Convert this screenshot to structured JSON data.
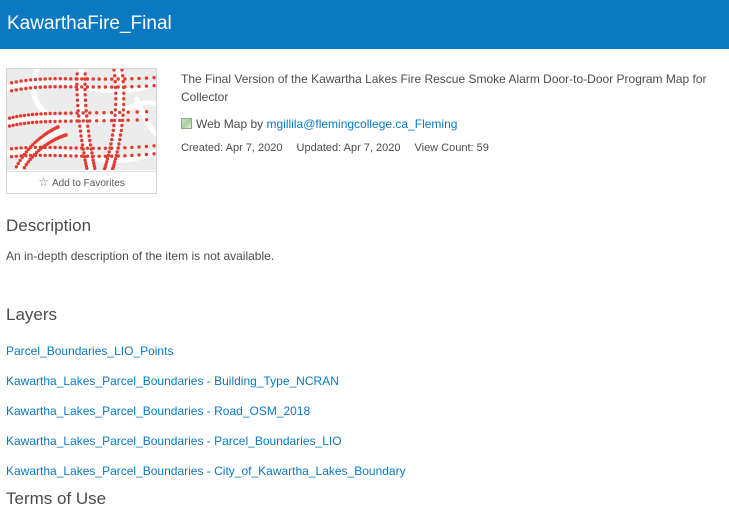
{
  "header": {
    "title": "KawarthaFire_Final",
    "bg_color": "#0a79c2"
  },
  "thumbnail": {
    "alt": "map thumbnail with red parcel points",
    "add_to_favorites_label": "Add to Favorites",
    "star_icon": "star-icon"
  },
  "item": {
    "summary": "The Final Version of the Kawartha Lakes Fire Rescue Smoke Alarm Door-to-Door Program Map for Collector",
    "type_icon": "webmap-icon",
    "type_label": "Web Map",
    "by_label": "by",
    "owner": "mgillila@flemingcollege.ca_Fleming",
    "created": "Created: Apr 7, 2020",
    "updated": "Updated: Apr 7, 2020",
    "view_count": "View Count: 59"
  },
  "description": {
    "title": "Description",
    "text": "An in-depth description of the item is not available."
  },
  "layers": {
    "title": "Layers",
    "items": [
      "Parcel_Boundaries_LIO_Points",
      "Kawartha_Lakes_Parcel_Boundaries - Building_Type_NCRAN",
      "Kawartha_Lakes_Parcel_Boundaries - Road_OSM_2018",
      "Kawartha_Lakes_Parcel_Boundaries - Parcel_Boundaries_LIO",
      "Kawartha_Lakes_Parcel_Boundaries - City_of_Kawartha_Lakes_Boundary"
    ]
  },
  "next_section": {
    "title": "Terms of Use"
  },
  "colors": {
    "accent": "#0a79c2",
    "text": "#4c4c4c",
    "map_points": "#e03c31"
  }
}
